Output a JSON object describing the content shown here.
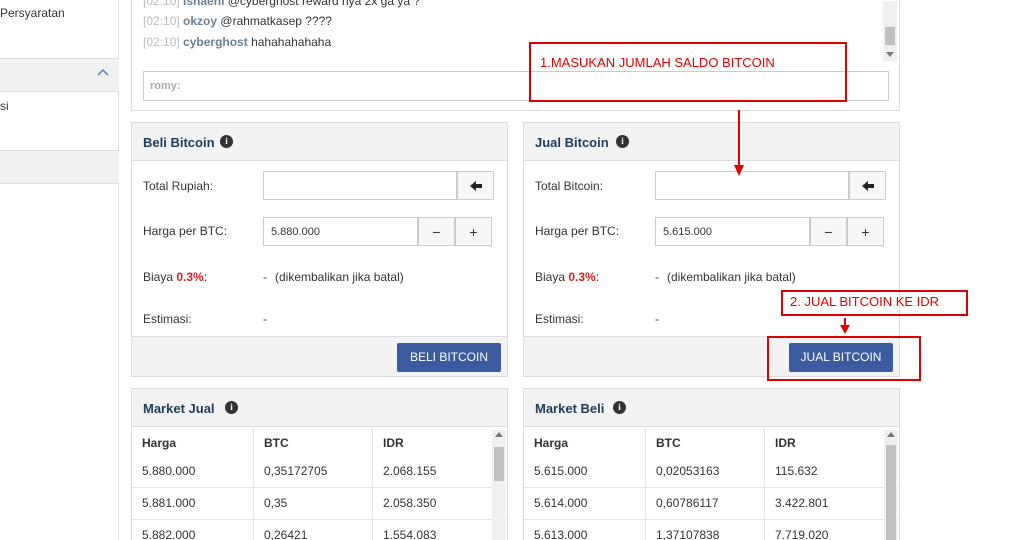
{
  "sidebar": {
    "link_label": "Persyaratan",
    "item_label": "si"
  },
  "chat": {
    "messages": [
      {
        "time": "[02:10]",
        "user": "isnaeni",
        "text": " @cyberghost reward nya 2x ga ya ?"
      },
      {
        "time": "[02:10]",
        "user": "okzoy",
        "text": " @rahmatkasep ????"
      },
      {
        "time": "[02:10]",
        "user": "cyberghost",
        "text": " hahahahahaha"
      }
    ],
    "input_user": "romy:"
  },
  "buy": {
    "title": "Beli Bitcoin",
    "total_label": "Total Rupiah:",
    "price_label": "Harga per BTC:",
    "price_value": "5.880.000",
    "fee_label": "Biaya ",
    "fee_pct": "0.3%",
    "fee_colon": ":",
    "fee_value": "-",
    "fee_note": "(dikembalikan jika batal)",
    "est_label": "Estimasi:",
    "est_value": "-",
    "button_label": "BELI BITCOIN",
    "minus": "−",
    "plus": "+"
  },
  "sell": {
    "title": "Jual Bitcoin",
    "total_label": "Total Bitcoin:",
    "price_label": "Harga per BTC:",
    "price_value": "5.615.000",
    "fee_label": "Biaya ",
    "fee_pct": "0.3%",
    "fee_colon": ":",
    "fee_value": "-",
    "fee_note": "(dikembalikan jika batal)",
    "est_label": "Estimasi:",
    "est_value": "-",
    "button_label": "JUAL BITCOIN",
    "minus": "−",
    "plus": "+"
  },
  "market_sell": {
    "title": "Market Jual",
    "columns": [
      "Harga",
      "BTC",
      "IDR"
    ],
    "rows": [
      [
        "5.880.000",
        "0,35172705",
        "2.068.155"
      ],
      [
        "5.881.000",
        "0,35",
        "2.058.350"
      ],
      [
        "5.882.000",
        "0,26421",
        "1.554.083"
      ]
    ]
  },
  "market_buy": {
    "title": "Market Beli",
    "columns": [
      "Harga",
      "BTC",
      "IDR"
    ],
    "rows": [
      [
        "5.615.000",
        "0,02053163",
        "115.632"
      ],
      [
        "5.614.000",
        "0,60786117",
        "3.422.801"
      ],
      [
        "5.613.000",
        "1,37107838",
        "7.719.020"
      ]
    ]
  },
  "annotations": {
    "step1": "1.MASUKAN JUMLAH SALDO BITCOIN",
    "step2": "2. JUAL BITCOIN KE IDR",
    "color": "#e00000"
  },
  "colors": {
    "button_blue": "#3b5aa0",
    "title_navy": "#1f3b5c",
    "fee_red": "#cc2222"
  },
  "icons": {
    "info": "info-icon",
    "backspace": "arrow-left-icon",
    "chevron": "chevron-up-icon"
  }
}
